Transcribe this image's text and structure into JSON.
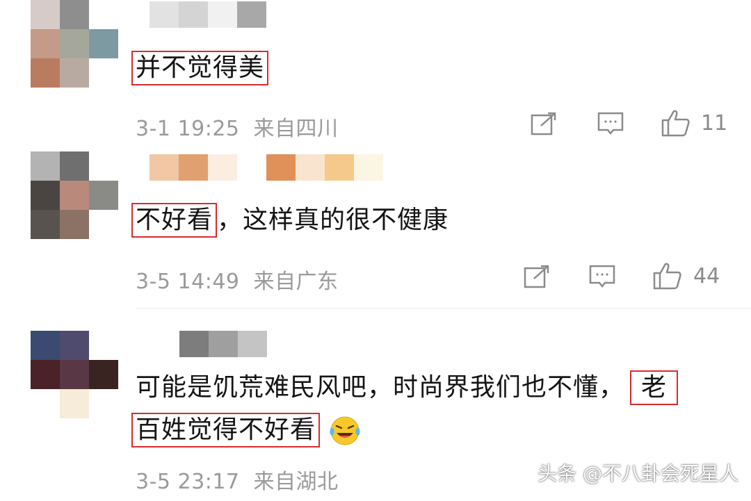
{
  "comments": [
    {
      "text_parts": [
        {
          "text": "并不觉得美",
          "highlight": true
        }
      ],
      "time": "3-1 19:25",
      "location": "来自四川",
      "likes": "11"
    },
    {
      "text_parts": [
        {
          "text": "不好看",
          "highlight": true
        },
        {
          "text": "，这样真的很不健康",
          "highlight": false
        }
      ],
      "time": "3-5 14:49",
      "location": "来自广东",
      "likes": "44"
    },
    {
      "line1": [
        {
          "text": "可能是饥荒难民风吧，时尚界我们也不懂，",
          "highlight": false
        },
        {
          "text": "老",
          "highlight": true
        }
      ],
      "line2": [
        {
          "text": "百姓觉得不好看",
          "highlight": true
        }
      ],
      "time": "3-5 23:17",
      "location": "来自湖北"
    }
  ],
  "icons": {
    "share": "share-icon",
    "comment": "comment-icon",
    "like": "thumbs-up-icon",
    "emoji": "laughing-crying-emoji"
  },
  "colors": {
    "highlight_border": "#d92b2b",
    "meta_text": "#9a9a9a"
  },
  "watermark": "头条 @不八卦会死星人"
}
